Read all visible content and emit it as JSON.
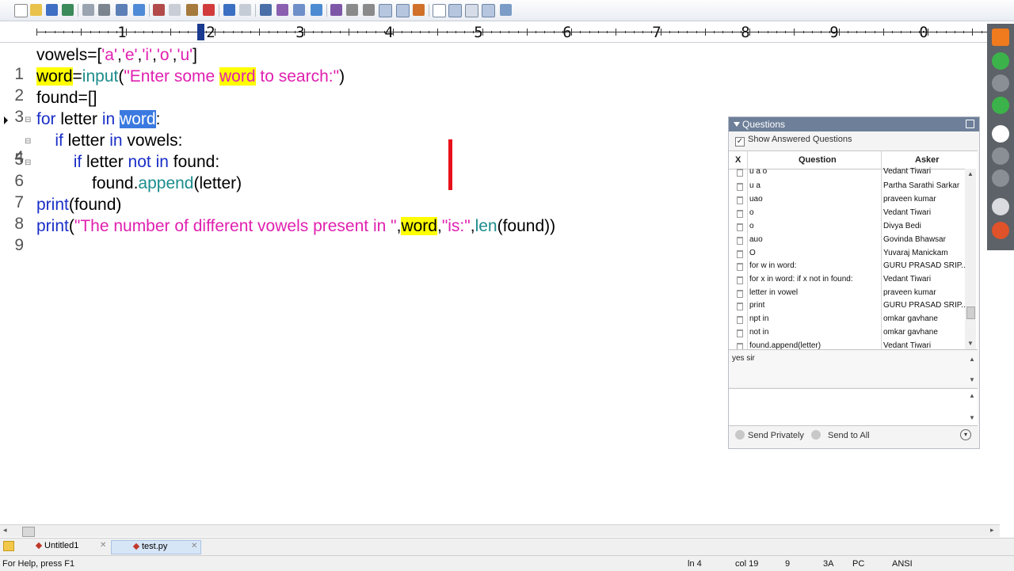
{
  "toolbar": {
    "icons": [
      "new-icon",
      "open-icon",
      "save-icon",
      "save-all-icon",
      "print-preview-icon",
      "print-icon",
      "spellcheck-icon",
      "find-in-files-icon",
      "cut-icon",
      "copy-icon",
      "paste-icon",
      "delete-icon",
      "undo-icon",
      "redo-icon",
      "find-icon",
      "replace-icon",
      "goto-icon",
      "marker-icon",
      "font-icon",
      "hex-icon",
      "wordwrap-icon",
      "column-mode-icon",
      "abc-icon",
      "check-icon",
      "window-icon",
      "window-tile-icon",
      "window-cascade-icon",
      "window-fullscreen-icon",
      "help-icon"
    ]
  },
  "ruler": {
    "labels": [
      "1",
      "2",
      "3",
      "4",
      "5",
      "6",
      "7",
      "8",
      "9",
      "0"
    ]
  },
  "editor": {
    "lines": [
      {
        "num": "1"
      },
      {
        "num": "2"
      },
      {
        "num": "3"
      },
      {
        "num": "4"
      },
      {
        "num": "5"
      },
      {
        "num": "6"
      },
      {
        "num": "7"
      },
      {
        "num": "8"
      },
      {
        "num": "9"
      }
    ],
    "code": {
      "l1": {
        "a": "vowels=[",
        "s1": "'a'",
        "c1": ",",
        "s2": "'e'",
        "c2": ",",
        "s3": "'i'",
        "c3": ",",
        "s4": "'o'",
        "c4": ",",
        "s5": "'u'",
        "e": "]"
      },
      "l2": {
        "w": "word",
        "eq": "=",
        "fn": "input",
        "p": "(",
        "s1": "\"Enter some ",
        "hw": "word",
        "s2": " to search:\"",
        "e": ")"
      },
      "l3": {
        "t": "found=[]"
      },
      "l4": {
        "kw1": "for",
        "t1": " letter ",
        "kw2": "in",
        "sp": " ",
        "sel": "word",
        "e": ":"
      },
      "l5": {
        "ind": "    ",
        "kw1": "if",
        "t1": " letter ",
        "kw2": "in",
        "t2": " vowels:"
      },
      "l6": {
        "ind": "        ",
        "kw1": "if",
        "t1": " letter ",
        "kw2": "not",
        "sp": " ",
        "kw3": "in",
        "t2": " found:"
      },
      "l7": {
        "ind": "            ",
        "t1": "found.",
        "fn": "append",
        "t2": "(letter)"
      },
      "l8": {
        "kw": "print",
        "t": "(found)"
      },
      "l9": {
        "kw": "print",
        "p": "(",
        "s1": "\"The number of different vowels present in \"",
        "c1": ",",
        "w": "word",
        "c2": ",",
        "s2": "\"is:\"",
        "c3": ",",
        "fn": "len",
        "e": "(found))"
      }
    },
    "annotation_color": "#e8101a"
  },
  "questions": {
    "title": "Questions",
    "show_answered": "Show Answered Questions",
    "columns": {
      "x": "X",
      "question": "Question",
      "asker": "Asker"
    },
    "rows": [
      {
        "q": "u a o",
        "a": "Vedant Tiwari"
      },
      {
        "q": "u a",
        "a": "Partha Sarathi Sarkar"
      },
      {
        "q": "uao",
        "a": "praveen kumar"
      },
      {
        "q": "o",
        "a": "Vedant Tiwari"
      },
      {
        "q": "o",
        "a": "Divya Bedi"
      },
      {
        "q": "auo",
        "a": "Govinda Bhawsar"
      },
      {
        "q": "O",
        "a": "Yuvaraj Manickam"
      },
      {
        "q": "for w in word:",
        "a": "GURU PRASAD SRIP..."
      },
      {
        "q": "for x in word: if x not in found:",
        "a": "Vedant Tiwari"
      },
      {
        "q": "letter in vowel",
        "a": "praveen kumar"
      },
      {
        "q": "print",
        "a": "GURU PRASAD SRIP..."
      },
      {
        "q": "npt in",
        "a": "omkar gavhane"
      },
      {
        "q": "not in",
        "a": "omkar gavhane"
      },
      {
        "q": "found.append(letter)",
        "a": "Vedant Tiwari"
      }
    ],
    "answer_text": "yes sir",
    "send_privately": "Send Privately",
    "send_to_all": "Send to All"
  },
  "side_strip": {
    "buttons": [
      "back-arrow-icon",
      "microphone-icon",
      "camera-icon",
      "screen-share-icon",
      "pause-icon",
      "mouse-icon",
      "chat-icon",
      "pen-icon",
      "hand-icon"
    ]
  },
  "tabs": [
    {
      "label": "Untitled1"
    },
    {
      "label": "test.py"
    }
  ],
  "status": {
    "help": "For Help, press F1",
    "ln": "ln 4",
    "col": "col 19",
    "n": "9",
    "hex": "3A",
    "mode": "PC",
    "enc": "ANSI"
  }
}
